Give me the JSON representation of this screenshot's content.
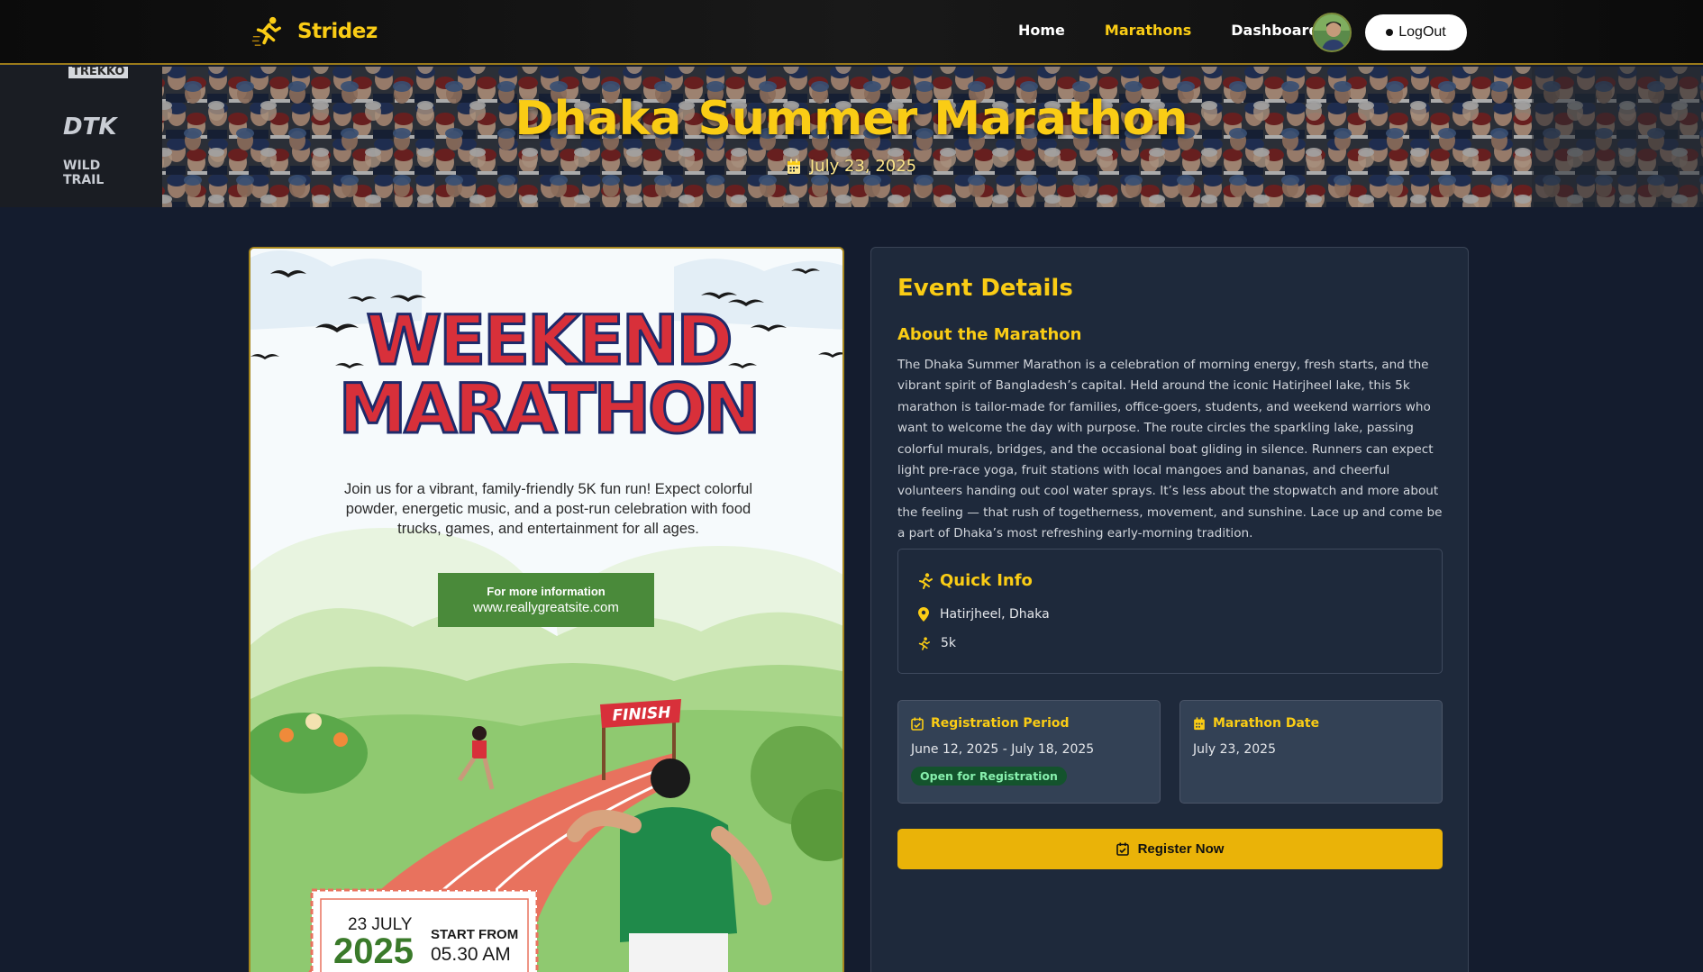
{
  "brand": {
    "name": "Stridez"
  },
  "nav": {
    "links": [
      {
        "label": "Home"
      },
      {
        "label": "Marathons"
      },
      {
        "label": "Dashboard"
      }
    ],
    "active": "Marathons",
    "logout_label": "LogOut"
  },
  "hero": {
    "title": "Dhaka Summer Marathon",
    "date": "July 23, 2025",
    "banner_signs": [
      "TREKKO",
      "DTK",
      "WILD",
      "TRAIL"
    ]
  },
  "poster": {
    "headline_1": "WEEKEND",
    "headline_2": "MARATHON",
    "description": "Join us for a vibrant, family-friendly 5K fun run! Expect colorful powder, energetic music, and a post-run celebration with food trucks, games, and entertainment for all ages.",
    "info_label": "For more information",
    "info_url": "www.reallygreatsite.com",
    "finish_label": "FINISH",
    "date_day": "23 JULY",
    "date_year": "2025",
    "start_label": "START FROM",
    "start_time": "05.30 AM"
  },
  "details": {
    "title": "Event Details",
    "about_title": "About the Marathon",
    "about_text": "The Dhaka Summer Marathon is a celebration of morning energy, fresh starts, and the vibrant spirit of Bangladesh’s capital. Held around the iconic Hatirjheel lake, this 5k marathon is tailor-made for families, office-goers, students, and weekend warriors who want to welcome the day with purpose. The route circles the sparkling lake, passing colorful murals, bridges, and the occasional boat gliding in silence. Runners can expect light pre-race yoga, fruit stations with local mangoes and bananas, and cheerful volunteers handing out cool water sprays. It’s less about the stopwatch and more about the feeling — that rush of togetherness, movement, and sunshine. Lace up and come be a part of Dhaka’s most refreshing early-morning tradition.",
    "quick_info": {
      "title": "Quick Info",
      "location": "Hatirjheel, Dhaka",
      "distance": "5k"
    },
    "registration": {
      "title": "Registration Period",
      "value": "June 12, 2025 - July 18, 2025",
      "status": "Open for Registration"
    },
    "marathon_date": {
      "title": "Marathon Date",
      "value": "July 23, 2025"
    },
    "register_label": "Register Now"
  },
  "colors": {
    "accent": "#facc15",
    "button": "#eab308",
    "page_bg": "#141c2e",
    "panel_bg": "#1e293b",
    "badge_bg": "#14532d",
    "badge_text": "#86efac"
  },
  "icons": [
    "runner-logo-icon",
    "calendar-icon",
    "runner-icon",
    "location-pin-icon",
    "calendar-check-icon"
  ]
}
